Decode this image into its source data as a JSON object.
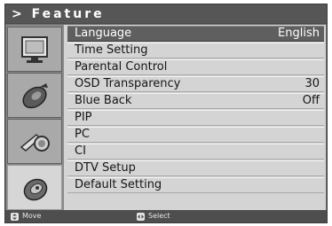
{
  "header": {
    "title": "> Feature"
  },
  "menu": {
    "items": [
      {
        "label": "Language",
        "value": "English",
        "selected": true
      },
      {
        "label": "Time Setting",
        "value": ""
      },
      {
        "label": "Parental Control",
        "value": ""
      },
      {
        "label": "OSD Transparency",
        "value": "30"
      },
      {
        "label": "Blue Back",
        "value": "Off"
      },
      {
        "label": "PIP",
        "value": ""
      },
      {
        "label": "PC",
        "value": ""
      },
      {
        "label": "CI",
        "value": ""
      },
      {
        "label": "DTV Setup",
        "value": ""
      },
      {
        "label": "Default Setting",
        "value": ""
      }
    ]
  },
  "sidebar": {
    "icons": [
      {
        "name": "picture-icon"
      },
      {
        "name": "sound-icon"
      },
      {
        "name": "channel-icon"
      },
      {
        "name": "feature-icon",
        "active": true
      }
    ]
  },
  "footer": {
    "move_label": "Move",
    "select_label": "Select"
  },
  "colors": {
    "frame": "#6e6e6e",
    "title_bar": "#565656",
    "list_background": "#d4d4d4",
    "selected_row": "#5f5f5f",
    "footer": "#4e4e4e"
  }
}
